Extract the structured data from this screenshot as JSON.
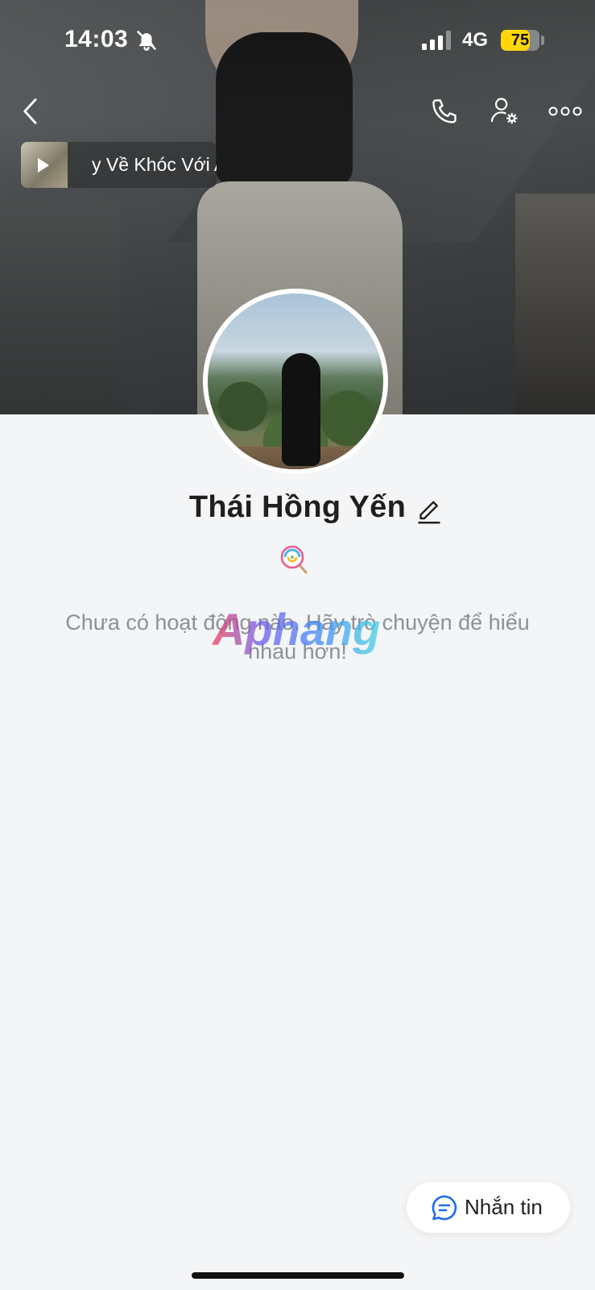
{
  "status_bar": {
    "time": "14:03",
    "network": "4G",
    "battery_level": 75,
    "battery_label": "75",
    "icons": [
      "bell-off-icon",
      "signal-icon",
      "battery-icon"
    ]
  },
  "header": {
    "icons": [
      "back-icon",
      "phone-icon",
      "user-settings-icon",
      "more-icon"
    ]
  },
  "music": {
    "title": "y Về Khóc Với A",
    "icon": "play-icon"
  },
  "profile": {
    "name": "Thái Hồng Yến",
    "status_emoji": "🍭",
    "empty_message": "Chưa có hoạt động nào. Hãy trò chuyện để hiểu nhau hơn!",
    "watermark": "Aphang"
  },
  "actions": {
    "message_label": "Nhắn tin",
    "message_icon": "chat-icon"
  },
  "colors": {
    "accent": "#1e6bf0",
    "battery": "#ffd60a",
    "background": "#f4f5f7"
  }
}
